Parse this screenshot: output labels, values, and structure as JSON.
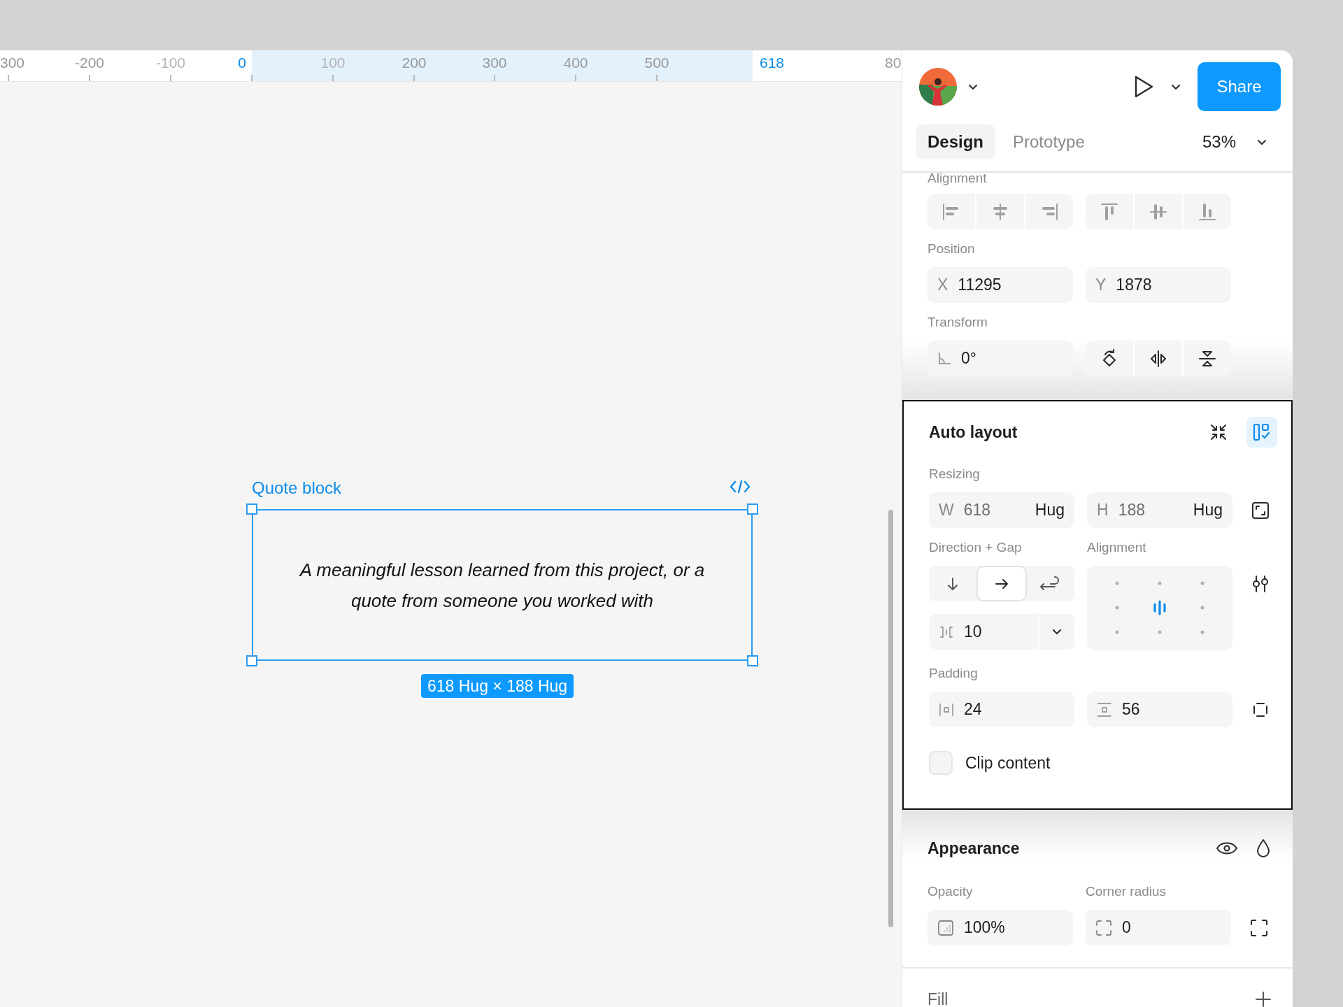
{
  "ruler": {
    "labels": [
      {
        "text": "300",
        "kind": "normal"
      },
      {
        "text": "-200",
        "kind": "normal"
      },
      {
        "text": "-100",
        "kind": "faint"
      },
      {
        "text": "0",
        "kind": "marker"
      },
      {
        "text": "100",
        "kind": "faint"
      },
      {
        "text": "200",
        "kind": "normal"
      },
      {
        "text": "300",
        "kind": "normal"
      },
      {
        "text": "400",
        "kind": "normal"
      },
      {
        "text": "500",
        "kind": "normal"
      },
      {
        "text": "618",
        "kind": "marker"
      },
      {
        "text": "80",
        "kind": "normal"
      }
    ]
  },
  "canvas": {
    "frame_name": "Quote block",
    "quote": "A meaningful lesson learned from this project, or a quote from someone you worked with",
    "size_badge": "618 Hug × 188 Hug"
  },
  "header": {
    "share": "Share",
    "zoom": "53%"
  },
  "tabs": [
    {
      "label": "Design",
      "selected": true
    },
    {
      "label": "Prototype",
      "selected": false
    }
  ],
  "alignment": {
    "label": "Alignment"
  },
  "position": {
    "label": "Position",
    "fields": [
      {
        "prefix": "X",
        "value": "11295"
      },
      {
        "prefix": "Y",
        "value": "1878"
      }
    ]
  },
  "transform": {
    "label": "Transform",
    "rotation": "0°"
  },
  "auto_layout": {
    "title": "Auto layout",
    "layout_guide_selected": true,
    "resizing": {
      "label": "Resizing",
      "fields": [
        {
          "prefix": "W",
          "value": "618",
          "mode": "Hug"
        },
        {
          "prefix": "H",
          "value": "188",
          "mode": "Hug"
        }
      ]
    },
    "direction": {
      "label": "Direction + Gap",
      "options": [
        {
          "kind": "down",
          "selected": false
        },
        {
          "kind": "right",
          "selected": true
        },
        {
          "kind": "wrap",
          "selected": false
        }
      ],
      "gap": "10"
    },
    "alignment": {
      "label": "Alignment",
      "cells": [
        {
          "selected": false
        },
        {
          "selected": false
        },
        {
          "selected": false
        },
        {
          "selected": false
        },
        {
          "selected": true
        },
        {
          "selected": false
        },
        {
          "selected": false
        },
        {
          "selected": false
        },
        {
          "selected": false
        }
      ]
    },
    "padding": {
      "label": "Padding",
      "horizontal": "24",
      "vertical": "56"
    },
    "clip_content": {
      "label": "Clip content",
      "checked": false
    }
  },
  "appearance": {
    "title": "Appearance",
    "opacity_label": "Opacity",
    "opacity": "100%",
    "radius_label": "Corner radius",
    "radius": "0"
  },
  "fill": {
    "title": "Fill"
  }
}
